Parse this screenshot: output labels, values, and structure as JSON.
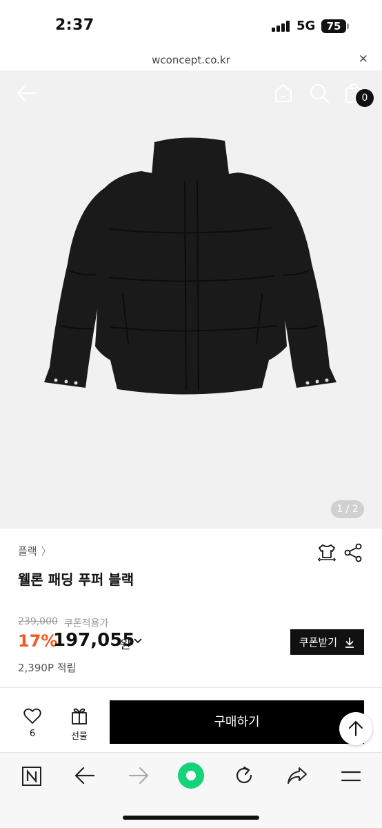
{
  "status": {
    "time": "2:37",
    "network": "5G",
    "battery": "75"
  },
  "url_bar": {
    "domain": "wconcept.co.kr"
  },
  "header": {
    "cart_count": "0"
  },
  "gallery": {
    "page_indicator": "1 / 2"
  },
  "product": {
    "brand": "플랙",
    "title": "웰론 패딩 푸퍼 블랙",
    "original_price": "239,000",
    "coupon_applied_label": "쿠폰적용가",
    "discount_rate": "17%",
    "price": "197,055",
    "currency": "원",
    "points": "2,390P 적립"
  },
  "coupon_button": {
    "label": "쿠폰받기"
  },
  "actions": {
    "like_count": "6",
    "gift_label": "선물",
    "buy_label": "구매하기"
  },
  "colors": {
    "discount": "#f05a1e",
    "buy_button": "#000000",
    "product_bg": "#f1f1f1"
  },
  "icons": [
    "back-arrow-icon",
    "home-icon",
    "search-icon",
    "shopping-bag-icon",
    "size-guide-icon",
    "share-icon",
    "heart-icon",
    "gift-icon",
    "download-icon",
    "arrow-up-icon",
    "naver-icon",
    "browser-back-icon",
    "browser-forward-icon",
    "green-dot-icon",
    "reload-icon",
    "browser-share-icon",
    "menu-icon"
  ]
}
